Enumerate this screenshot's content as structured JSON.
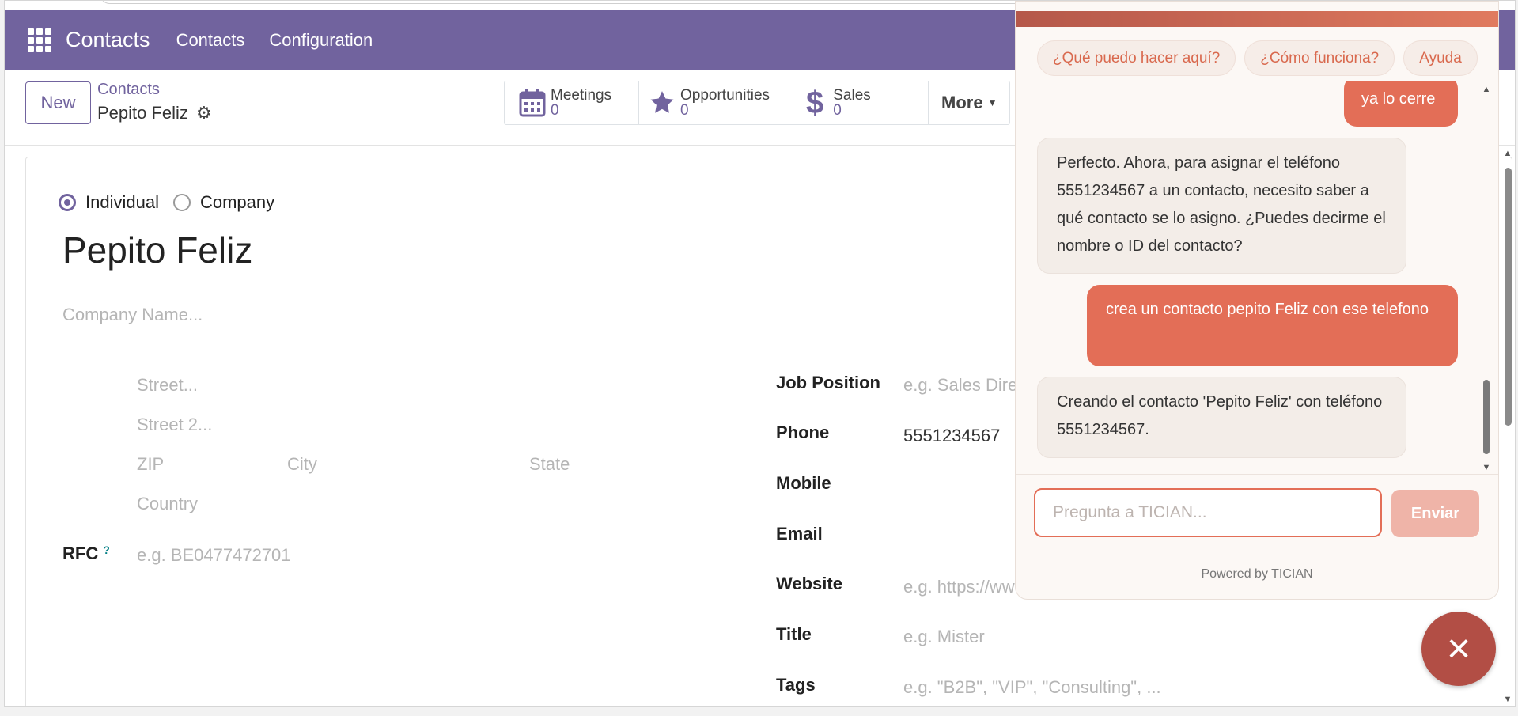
{
  "navbar": {
    "brand": "Contacts",
    "menu": [
      "Contacts",
      "Configuration"
    ]
  },
  "control": {
    "new_label": "New",
    "breadcrumb": "Contacts",
    "record_name": "Pepito Feliz",
    "stats": [
      {
        "label": "Meetings",
        "value": "0",
        "icon": "calendar-icon"
      },
      {
        "label": "Opportunities",
        "value": "0",
        "icon": "star-icon"
      },
      {
        "label": "Sales",
        "value": "0",
        "icon": "dollar-icon"
      }
    ],
    "more_label": "More"
  },
  "form": {
    "type_options": [
      "Individual",
      "Company"
    ],
    "selected_type": "Individual",
    "name": "Pepito Feliz",
    "company_placeholder": "Company Name...",
    "street_placeholder": "Street...",
    "street2_placeholder": "Street 2...",
    "zip_placeholder": "ZIP",
    "city_placeholder": "City",
    "state_placeholder": "State",
    "country_placeholder": "Country",
    "rfc_label": "RFC",
    "rfc_help": "?",
    "rfc_placeholder": "e.g. BE0477472701",
    "job_position_label": "Job Position",
    "job_position_placeholder": "e.g. Sales Dire",
    "phone_label": "Phone",
    "phone_value": "5551234567",
    "mobile_label": "Mobile",
    "email_label": "Email",
    "website_label": "Website",
    "website_placeholder": "e.g. https://ww",
    "title_label": "Title",
    "title_placeholder": "e.g. Mister",
    "tags_label": "Tags",
    "tags_placeholder": "e.g. \"B2B\", \"VIP\", \"Consulting\", ..."
  },
  "chat": {
    "chips": [
      "¿Qué puedo hacer aquí?",
      "¿Cómo funciona?",
      "Ayuda"
    ],
    "messages": [
      {
        "role": "user",
        "text": "ya lo cerre"
      },
      {
        "role": "bot",
        "text": "Perfecto. Ahora, para asignar el teléfono 5551234567 a un contacto, necesito saber a qué contacto se lo asigno. ¿Puedes decirme el nombre o ID del contacto?"
      },
      {
        "role": "user",
        "text": "crea un contacto pepito Feliz con ese telefono"
      },
      {
        "role": "bot",
        "text": "Creando el contacto 'Pepito Feliz' con teléfono 5551234567."
      }
    ],
    "input_placeholder": "Pregunta a TICIAN...",
    "send_label": "Enviar",
    "powered_by": "Powered by TICIAN",
    "close_icon": "×"
  },
  "colors": {
    "brand_purple": "#71639e",
    "chat_accent": "#e36e57",
    "fab": "#b24e45"
  }
}
